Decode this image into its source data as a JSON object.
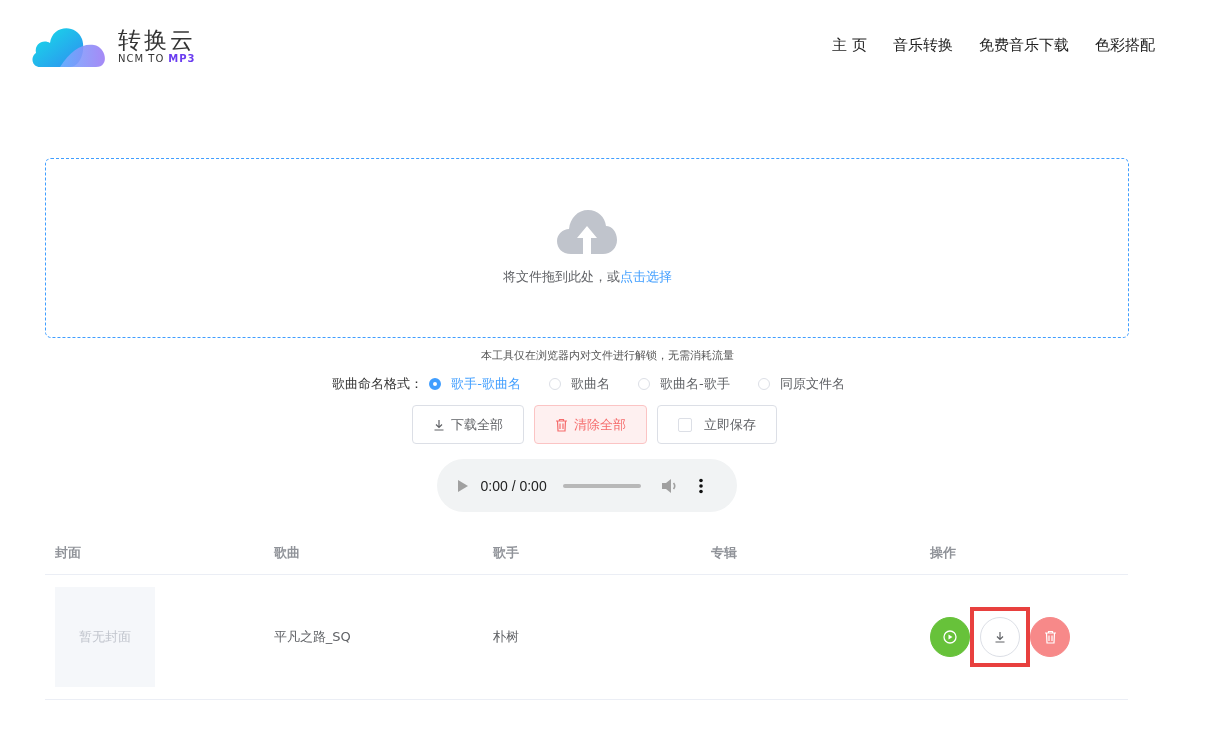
{
  "logo": {
    "name": "转换云",
    "tagline_prefix": "NCM TO",
    "tagline_suffix": "MP3"
  },
  "nav": [
    {
      "label": "主 页"
    },
    {
      "label": "音乐转换"
    },
    {
      "label": "免费音乐下载"
    },
    {
      "label": "色彩搭配"
    }
  ],
  "upload": {
    "text": "将文件拖到此处，或",
    "link": "点击选择"
  },
  "notice": "本工具仅在浏览器内对文件进行解锁，无需消耗流量",
  "naming": {
    "label": "歌曲命名格式：",
    "options": [
      {
        "label": "歌手-歌曲名",
        "selected": true
      },
      {
        "label": "歌曲名",
        "selected": false
      },
      {
        "label": "歌曲名-歌手",
        "selected": false
      },
      {
        "label": "同原文件名",
        "selected": false
      }
    ]
  },
  "buttons": [
    {
      "kind": "download",
      "label": "下载全部"
    },
    {
      "kind": "clear",
      "label": "清除全部"
    },
    {
      "kind": "checkbox",
      "label": "立即保存",
      "checked": false
    }
  ],
  "player": {
    "time": "0:00 / 0:00"
  },
  "table": {
    "columns": [
      "封面",
      "歌曲",
      "歌手",
      "专辑",
      "操作"
    ],
    "rows": [
      {
        "cover": "暂无封面",
        "song": "平凡之路_SQ",
        "artist": "朴树",
        "album": "",
        "actions": [
          {
            "kind": "play",
            "highlighted": false
          },
          {
            "kind": "download",
            "highlighted": true
          },
          {
            "kind": "delete",
            "highlighted": false
          }
        ]
      }
    ]
  }
}
